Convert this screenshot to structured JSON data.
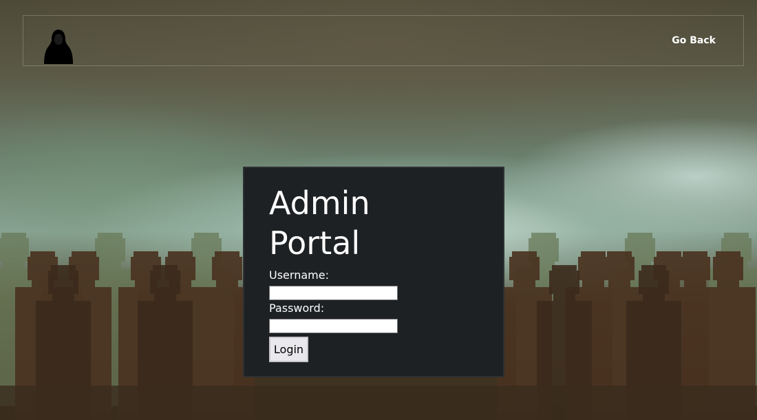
{
  "navbar": {
    "logo": "hooded-figure-icon",
    "go_back_label": "Go Back"
  },
  "login_card": {
    "title": "Admin Portal",
    "username_label": "Username:",
    "username_value": "",
    "password_label": "Password:",
    "password_value": "",
    "login_button_label": "Login"
  },
  "colors": {
    "card_background": "#1e2124",
    "text": "#ffffff",
    "button_background": "#e9e9ed"
  }
}
